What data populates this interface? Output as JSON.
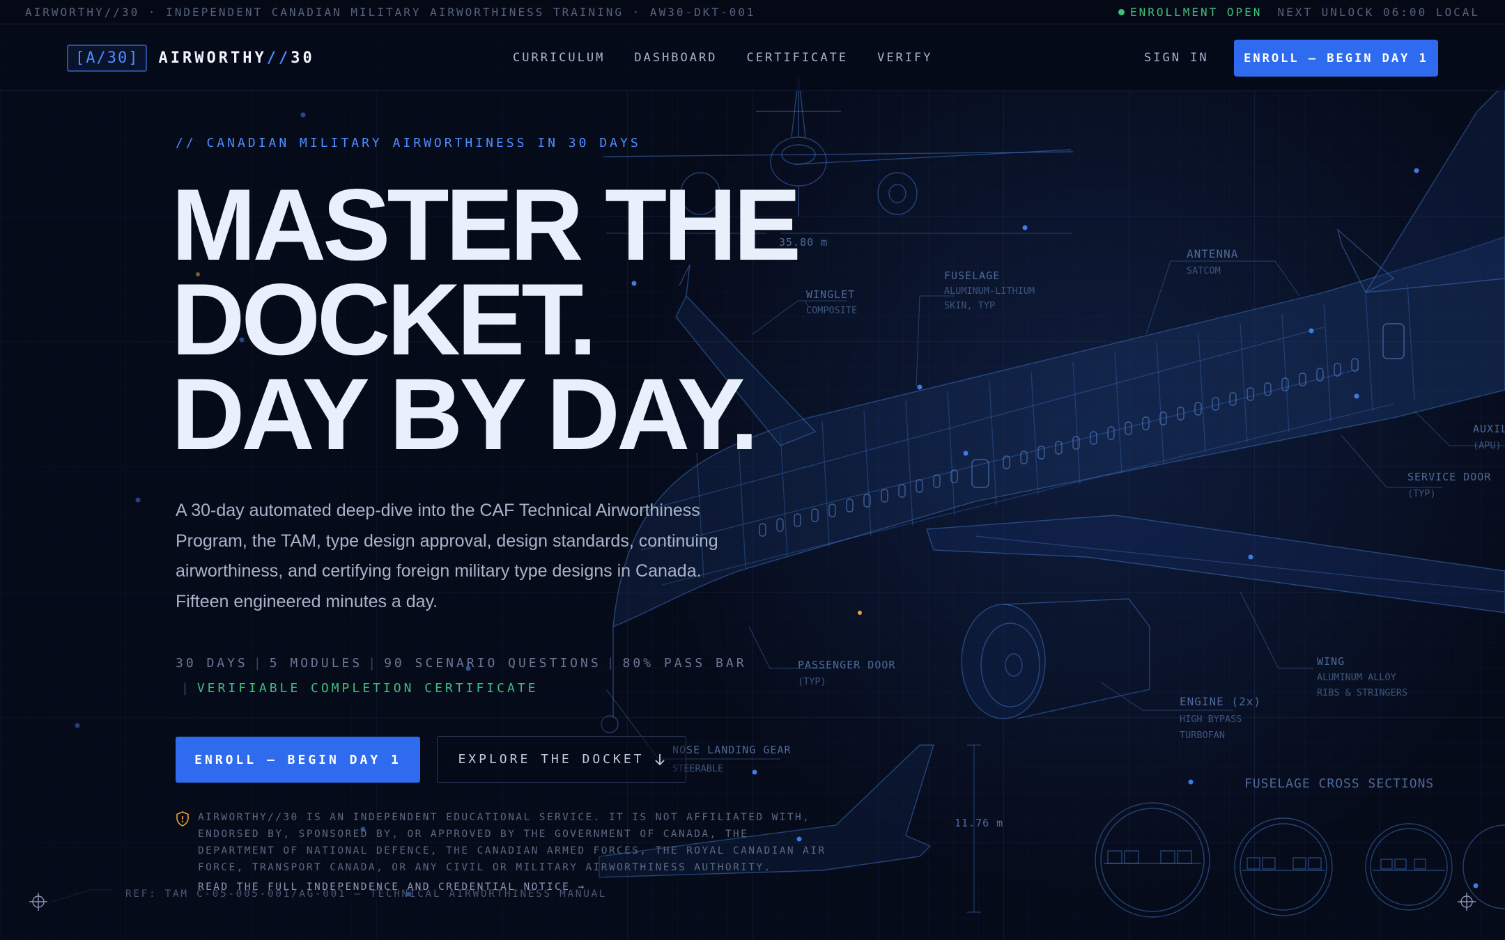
{
  "statusbar": {
    "left_text": "AIRWORTHY//30 · INDEPENDENT CANADIAN MILITARY AIRWORTHINESS TRAINING · AW30-DKT-001",
    "enrollment": "ENROLLMENT OPEN",
    "next_unlock": "NEXT UNLOCK 06:00 LOCAL",
    "status_color": "#3fbf7a"
  },
  "nav": {
    "logo_badge": "[A/30]",
    "logo_name": "AIRWORTHY",
    "logo_slash": "//",
    "logo_num": "30",
    "links": [
      "CURRICULUM",
      "DASHBOARD",
      "CERTIFICATE",
      "VERIFY"
    ],
    "sign_in": "SIGN IN",
    "cta": "ENROLL — BEGIN DAY 1"
  },
  "hero": {
    "eyebrow": "// CANADIAN MILITARY AIRWORTHINESS IN 30 DAYS",
    "headline": [
      "MASTER THE",
      "DOCKET.",
      "DAY BY DAY."
    ],
    "lede": "A 30-day automated deep-dive into the CAF Technical Airworthiness Program, the TAM, type design approval, design standards, continuing airworthiness, and certifying foreign military type designs in Canada. Fifteen engineered minutes a day.",
    "stats": [
      "30 DAYS",
      "5 MODULES",
      "90 SCENARIO QUESTIONS",
      "80% PASS BAR"
    ],
    "cert_stat": "VERIFIABLE COMPLETION CERTIFICATE",
    "primary_cta": "ENROLL — BEGIN DAY 1",
    "secondary_cta": "EXPLORE THE DOCKET",
    "notice": "AIRWORTHY//30 IS AN INDEPENDENT EDUCATIONAL SERVICE. IT IS NOT AFFILIATED WITH, ENDORSED BY, SPONSORED BY, OR APPROVED BY THE GOVERNMENT OF CANADA, THE DEPARTMENT OF NATIONAL DEFENCE, THE CANADIAN ARMED FORCES, THE ROYAL CANADIAN AIR FORCE, TRANSPORT CANADA, OR ANY CIVIL OR MILITARY AIRWORTHINESS AUTHORITY.",
    "notice_link": "READ THE FULL INDEPENDENCE AND CREDENTIAL NOTICE →",
    "ref": "REF: TAM C-05-005-001/AG-001 — TECHNICAL AIRWORTHINESS MANUAL"
  },
  "blueprint": {
    "wingspan": "35.80 m",
    "height": "11.76 m",
    "winglet": [
      "WINGLET",
      "COMPOSITE"
    ],
    "fuselage": [
      "FUSELAGE",
      "ALUMINUM-LITHIUM",
      "SKIN, TYP"
    ],
    "antenna": [
      "ANTENNA",
      "SATCOM"
    ],
    "apu": [
      "AUXIL",
      "(APU)"
    ],
    "service_door": [
      "SERVICE DOOR",
      "(TYP)"
    ],
    "passenger_door": [
      "PASSENGER DOOR",
      "(TYP)"
    ],
    "wing": [
      "WING",
      "ALUMINUM ALLOY",
      "RIBS & STRINGERS"
    ],
    "engine": [
      "ENGINE (2x)",
      "HIGH BYPASS",
      "TURBOFAN"
    ],
    "nose_gear": [
      "NOSE LANDING GEAR",
      "STEERABLE"
    ],
    "cross_sections": "FUSELAGE CROSS SECTIONS"
  },
  "colors": {
    "accent": "#2f6bef",
    "accent_text": "#4f8cff",
    "background": "#060b1a",
    "success": "#3fbf7a",
    "warning": "#e8a33a"
  }
}
